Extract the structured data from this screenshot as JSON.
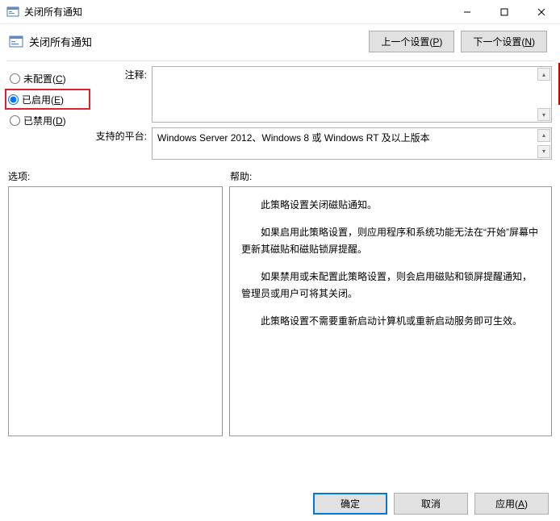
{
  "window": {
    "title": "关闭所有通知",
    "header_title": "关闭所有通知"
  },
  "nav": {
    "prev_label": "上一个设置(P)",
    "next_label": "下一个设置(N)"
  },
  "radios": {
    "not_configured": "未配置(C)",
    "enabled": "已启用(E)",
    "disabled": "已禁用(D)",
    "selected": "enabled"
  },
  "labels": {
    "comment": "注释:",
    "platform": "支持的平台:",
    "options": "选项:",
    "help": "帮助:"
  },
  "fields": {
    "comment_value": "",
    "platform_value": "Windows Server 2012、Windows 8 或 Windows RT 及以上版本"
  },
  "help": {
    "p1": "此策略设置关闭磁贴通知。",
    "p2": "如果启用此策略设置，则应用程序和系统功能无法在“开始”屏幕中更新其磁贴和磁贴锁屏提醒。",
    "p3": "如果禁用或未配置此策略设置，则会启用磁贴和锁屏提醒通知，管理员或用户可将其关闭。",
    "p4": "此策略设置不需要重新启动计算机或重新启动服务即可生效。"
  },
  "footer": {
    "ok": "确定",
    "cancel": "取消",
    "apply": "应用(A)"
  }
}
